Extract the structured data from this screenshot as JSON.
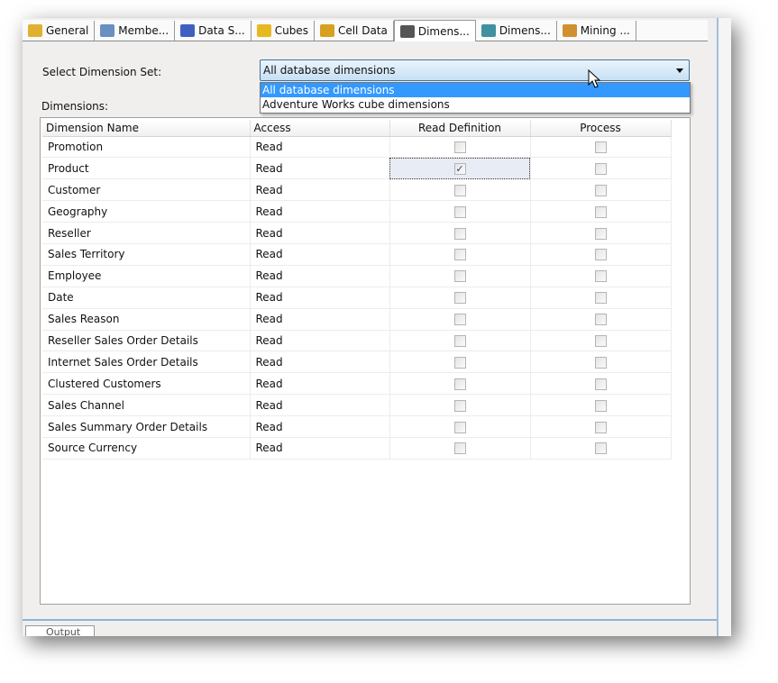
{
  "tabs": [
    {
      "label": "General",
      "icon": "general-icon",
      "color": "#e0b030"
    },
    {
      "label": "Membe...",
      "icon": "members-icon",
      "color": "#6a8fc0"
    },
    {
      "label": "Data S...",
      "icon": "data-sources-icon",
      "color": "#4060c0"
    },
    {
      "label": "Cubes",
      "icon": "cube-icon",
      "color": "#e8b820"
    },
    {
      "label": "Cell Data",
      "icon": "cell-data-icon",
      "color": "#d8a020"
    },
    {
      "label": "Dimens...",
      "icon": "dimension-icon",
      "color": "#555555",
      "active": true
    },
    {
      "label": "Dimens...",
      "icon": "dimension-data-icon",
      "color": "#4090a0"
    },
    {
      "label": "Mining ...",
      "icon": "mining-icon",
      "color": "#d09030"
    }
  ],
  "select_label": "Select Dimension Set:",
  "combo_value": "All database dimensions",
  "options": [
    "All database dimensions",
    "Adventure Works cube dimensions"
  ],
  "dimensions_label": "Dimensions:",
  "columns": [
    "Dimension Name",
    "Access",
    "Read Definition",
    "Process"
  ],
  "rows": [
    {
      "name": "Promotion",
      "access": "Read",
      "read_def": false,
      "process": false
    },
    {
      "name": "Product",
      "access": "Read",
      "read_def": true,
      "process": false
    },
    {
      "name": "Customer",
      "access": "Read",
      "read_def": false,
      "process": false
    },
    {
      "name": "Geography",
      "access": "Read",
      "read_def": false,
      "process": false
    },
    {
      "name": "Reseller",
      "access": "Read",
      "read_def": false,
      "process": false
    },
    {
      "name": "Sales Territory",
      "access": "Read",
      "read_def": false,
      "process": false
    },
    {
      "name": "Employee",
      "access": "Read",
      "read_def": false,
      "process": false
    },
    {
      "name": "Date",
      "access": "Read",
      "read_def": false,
      "process": false
    },
    {
      "name": "Sales Reason",
      "access": "Read",
      "read_def": false,
      "process": false
    },
    {
      "name": "Reseller Sales Order Details",
      "access": "Read",
      "read_def": false,
      "process": false
    },
    {
      "name": "Internet Sales Order Details",
      "access": "Read",
      "read_def": false,
      "process": false
    },
    {
      "name": "Clustered Customers",
      "access": "Read",
      "read_def": false,
      "process": false
    },
    {
      "name": "Sales Channel",
      "access": "Read",
      "read_def": false,
      "process": false
    },
    {
      "name": "Sales Summary Order Details",
      "access": "Read",
      "read_def": false,
      "process": false
    },
    {
      "name": "Source Currency",
      "access": "Read",
      "read_def": false,
      "process": false
    }
  ],
  "output_tab": "Output"
}
